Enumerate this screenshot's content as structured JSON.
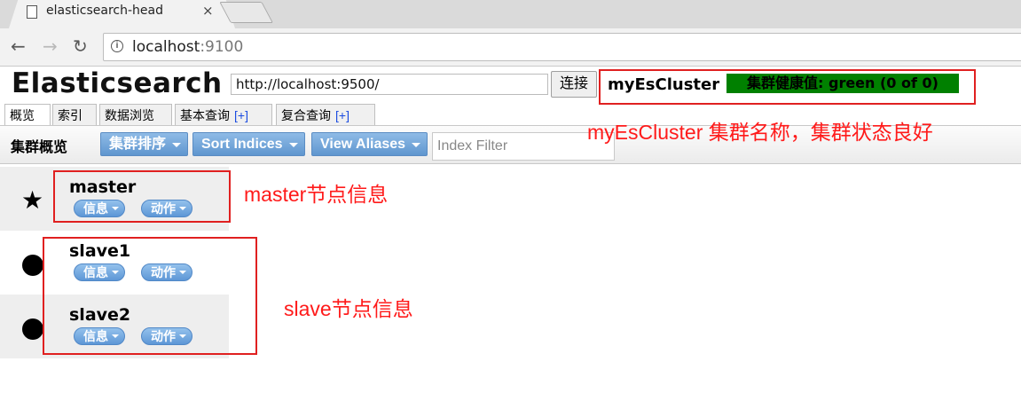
{
  "browser": {
    "tab_title": "elasticsearch-head",
    "tab_close": "×",
    "nav_back": "←",
    "nav_forward": "→",
    "nav_reload": "↻",
    "url_host": "localhost",
    "url_port": ":9100"
  },
  "app": {
    "title": "Elasticsearch",
    "connection_url": "http://localhost:9500/",
    "connect_label": "连接",
    "cluster_name": "myEsCluster",
    "health_text": "集群健康值: green (0 of 0)",
    "health_color": "#008000"
  },
  "tabs": [
    {
      "label": "概览",
      "plus": ""
    },
    {
      "label": "索引",
      "plus": ""
    },
    {
      "label": "数据浏览",
      "plus": ""
    },
    {
      "label": "基本查询",
      "plus": "[+]"
    },
    {
      "label": "复合查询",
      "plus": "[+]"
    }
  ],
  "toolbar": {
    "title": "集群概览",
    "cluster_sort": "集群排序",
    "sort_indices": "Sort Indices",
    "view_aliases": "View Aliases",
    "filter_placeholder": "Index Filter"
  },
  "nodes": [
    {
      "name": "master",
      "icon": "star-icon",
      "info": "信息",
      "action": "动作"
    },
    {
      "name": "slave1",
      "icon": "dot-icon",
      "info": "信息",
      "action": "动作"
    },
    {
      "name": "slave2",
      "icon": "dot-icon",
      "info": "信息",
      "action": "动作"
    }
  ],
  "annotations": {
    "cluster": "myEsCluster 集群名称，集群状态良好",
    "master": "master节点信息",
    "slave": "slave节点信息",
    "color": "#ff1a1a"
  }
}
